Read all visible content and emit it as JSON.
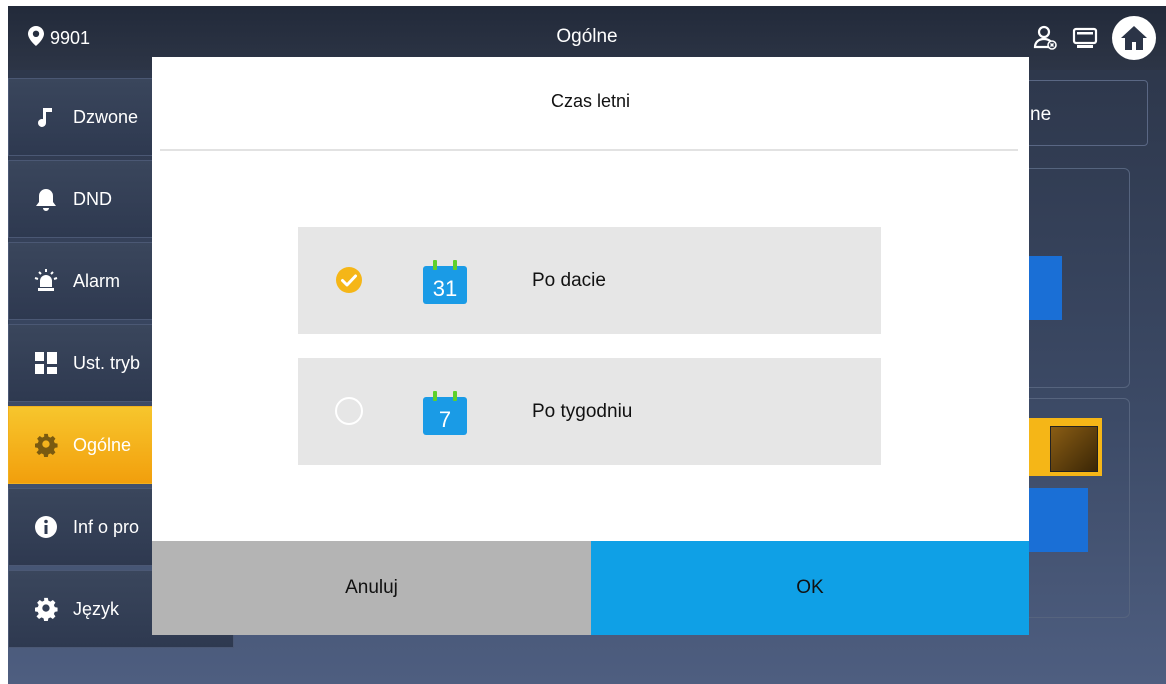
{
  "topbar": {
    "room_number": "9901",
    "title": "Ogólne",
    "icons": [
      "location-pin-icon",
      "contact-card-icon",
      "monitor-icon",
      "home-icon"
    ]
  },
  "sidebar": {
    "items": [
      {
        "label": "Dzwone",
        "icon": "music-note-icon",
        "active": false
      },
      {
        "label": "DND",
        "icon": "bell-icon",
        "active": false
      },
      {
        "label": "Alarm",
        "icon": "alarm-siren-icon",
        "active": false
      },
      {
        "label": "Ust. tryb",
        "icon": "grid-icon",
        "active": false
      },
      {
        "label": "Ogólne",
        "icon": "gear-icon",
        "active": true
      },
      {
        "label": "Inf o pro",
        "icon": "info-icon",
        "active": false
      },
      {
        "label": "Język",
        "icon": "gear-icon",
        "active": false
      }
    ]
  },
  "right_panel": {
    "text": "ne"
  },
  "dialog": {
    "title": "Czas letni",
    "options": [
      {
        "label": "Po dacie",
        "calendar_number": "31",
        "selected": true
      },
      {
        "label": "Po tygodniu",
        "calendar_number": "7",
        "selected": false
      }
    ],
    "cancel_label": "Anuluj",
    "ok_label": "OK"
  },
  "colors": {
    "accent_blue": "#0fa0e6",
    "active_item": "#f5b617",
    "check_orange": "#f5b617",
    "calendar_blue": "#1a9be6",
    "calendar_green": "#5ed12a"
  }
}
